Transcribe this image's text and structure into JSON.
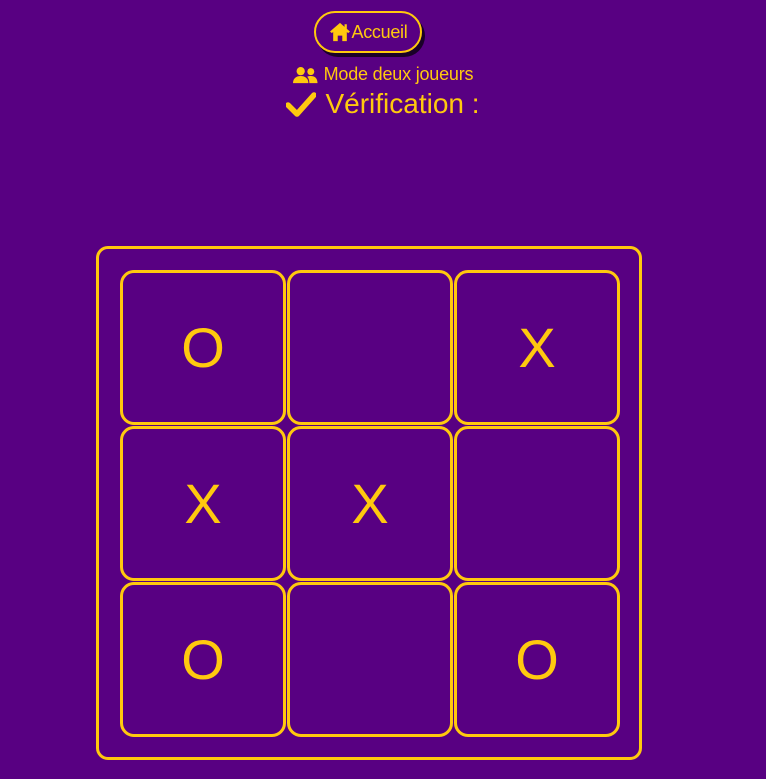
{
  "header": {
    "home_label": "Accueil",
    "mode_label": "Mode deux joueurs",
    "verification_label": "Vérification :"
  },
  "board": {
    "cells": [
      "O",
      "",
      "X",
      "X",
      "X",
      "",
      "O",
      "",
      "O"
    ]
  },
  "colors": {
    "background": "#580082",
    "accent": "#FFC90E"
  },
  "icons": {
    "home": "home-icon",
    "mode": "users-icon",
    "verification": "check-icon"
  }
}
